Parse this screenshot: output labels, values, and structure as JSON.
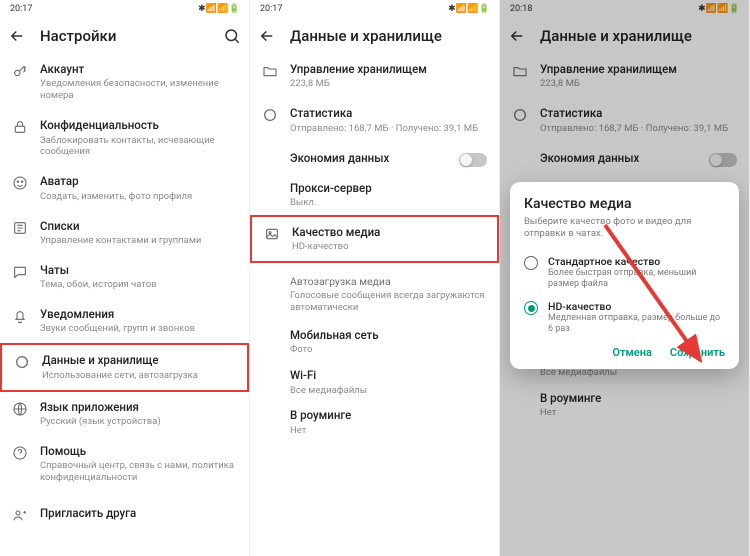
{
  "s1": {
    "time": "20:17",
    "title": "Настройки",
    "items": [
      {
        "p": "Аккаунт",
        "s": "Уведомления безопасности, изменение номера"
      },
      {
        "p": "Конфиденциальность",
        "s": "Заблокировать контакты, исчезающие сообщения"
      },
      {
        "p": "Аватар",
        "s": "Создать, изменить, фото профиля"
      },
      {
        "p": "Списки",
        "s": "Управление контактами и группами"
      },
      {
        "p": "Чаты",
        "s": "Тема, обои, история чатов"
      },
      {
        "p": "Уведомления",
        "s": "Звуки сообщений, групп и звонков"
      },
      {
        "p": "Данные и хранилище",
        "s": "Использование сети, автозагрузка"
      },
      {
        "p": "Язык приложения",
        "s": "Русский (язык устройства)"
      },
      {
        "p": "Помощь",
        "s": "Справочный центр, связь с нами, политика конфиденциальности"
      },
      {
        "p": "Пригласить друга",
        "s": ""
      }
    ]
  },
  "s2": {
    "time": "20:17",
    "title": "Данные и хранилище",
    "storage": {
      "p": "Управление хранилищем",
      "s": "223,8 МБ"
    },
    "stats": {
      "p": "Статистика",
      "s": "Отправлено: 168,7 МБ · Получено: 39,1 МБ"
    },
    "saver": "Экономия данных",
    "proxy": {
      "p": "Прокси-сервер",
      "s": "Выкл."
    },
    "quality": {
      "p": "Качество медиа",
      "s": "HD-качество"
    },
    "autodl": {
      "p": "Автозагрузка медиа",
      "s": "Голосовые сообщения всегда загружаются автоматически"
    },
    "mobile": {
      "p": "Мобильная сеть",
      "s": "Фото"
    },
    "wifi": {
      "p": "Wi-Fi",
      "s": "Все медиафайлы"
    },
    "roaming": {
      "p": "В роуминге",
      "s": "Нет"
    }
  },
  "s3": {
    "time": "20:18",
    "title": "Данные и хранилище",
    "dialog": {
      "title": "Качество медиа",
      "sub": "Выберите качество фото и видео для отправки в чатах.",
      "opt1": {
        "lbl": "Стандартное качество",
        "desc": "Более быстрая отправка, меньший размер файла"
      },
      "opt2": {
        "lbl": "HD-качество",
        "desc": "Медленная отправка, размер больше до 6 раз"
      },
      "cancel": "Отмена",
      "save": "Сохранить"
    }
  }
}
